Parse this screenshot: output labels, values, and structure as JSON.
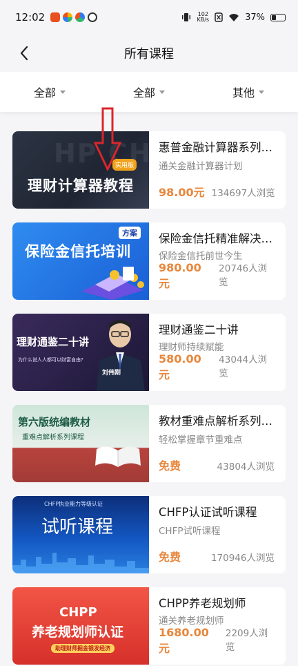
{
  "status": {
    "time": "12:02",
    "net_speed_value": "102",
    "net_speed_unit": "KB/s",
    "battery": "37%"
  },
  "nav": {
    "title": "所有课程",
    "back_icon": "chevron-left-icon"
  },
  "filters": [
    {
      "label": "全部"
    },
    {
      "label": "全部"
    },
    {
      "label": "其他"
    }
  ],
  "courses": [
    {
      "title": "惠普金融计算器系列…",
      "subtitle": "通关金融计算器计划",
      "price": "98.00元",
      "views": "134697人浏览",
      "thumb": {
        "main_text": "理财计算器教程",
        "badge": "实用版",
        "bg_text": "HP CHFP"
      }
    },
    {
      "title": "保险金信托精准解决…",
      "subtitle": "保险金信托前世今生",
      "price": "980.00元",
      "views": "20746人浏览",
      "thumb": {
        "main_text": "保险金信托培训",
        "badge": "方案"
      }
    },
    {
      "title": "理财通鉴二十讲",
      "subtitle": "理财师持续赋能",
      "price": "580.00元",
      "views": "43044人浏览",
      "thumb": {
        "main_text": "理财通鉴二十讲",
        "sub_text": "为什么说人人都可以财富自由?",
        "person_name": "刘伟刚"
      }
    },
    {
      "title": "教材重难点解析系列…",
      "subtitle": "轻松掌握章节重难点",
      "price": "免费",
      "views": "43804人浏览",
      "thumb": {
        "main_text": "第六版统编教材",
        "sub_text": "重难点解析系列课程"
      }
    },
    {
      "title": "CHFP认证试听课程",
      "subtitle": "CHFP试听课程",
      "price": "免费",
      "views": "170946人浏览",
      "thumb": {
        "main_text": "试听课程",
        "sub_text": "CHFP执业能力等级认证"
      }
    },
    {
      "title": "CHPP养老规划师",
      "subtitle": "通关养老规划师",
      "price": "1680.00元",
      "views": "2209人浏览",
      "thumb": {
        "main_text": "养老规划师认证",
        "top_text": "CHPP",
        "sub_text": "助理财师掘金银发经济"
      }
    }
  ],
  "colors": {
    "price": "#e8873c",
    "background": "#f5f5f7",
    "annotation_arrow": "#d9262c"
  }
}
